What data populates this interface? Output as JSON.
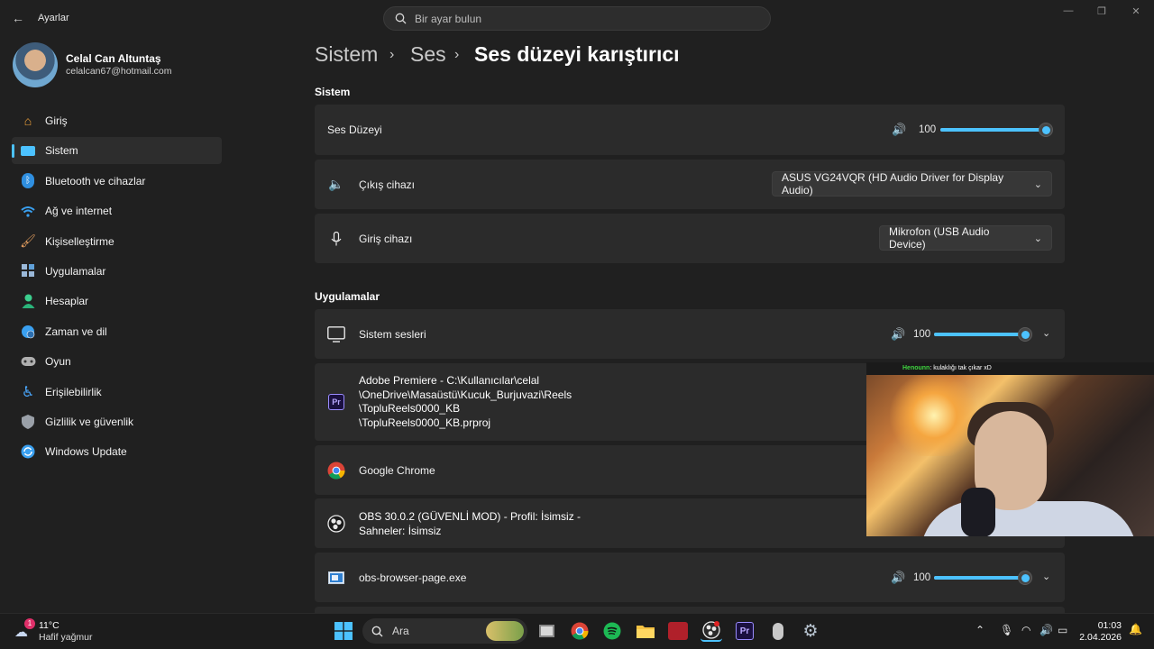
{
  "window": {
    "title": "Ayarlar",
    "search_placeholder": "Bir ayar bulun",
    "controls": [
      "minimize-icon",
      "maximize-icon",
      "close-icon"
    ]
  },
  "profile": {
    "name": "Celal Can Altuntaş",
    "email": "celalcan67@hotmail.com"
  },
  "sidebar": {
    "items": [
      {
        "label": "Giriş",
        "icon": "home-icon",
        "color": "#f3a33a"
      },
      {
        "label": "Sistem",
        "icon": "system-icon",
        "color": "#4cc2ff",
        "active": true
      },
      {
        "label": "Bluetooth ve cihazlar",
        "icon": "bluetooth-icon",
        "color": "#2f8fe0"
      },
      {
        "label": "Ağ ve internet",
        "icon": "wifi-icon",
        "color": "#3aa0f0"
      },
      {
        "label": "Kişiselleştirme",
        "icon": "brush-icon",
        "color": "#e8a060"
      },
      {
        "label": "Uygulamalar",
        "icon": "apps-icon",
        "color": "#9ab8d8"
      },
      {
        "label": "Hesaplar",
        "icon": "account-icon",
        "color": "#3ccf8e"
      },
      {
        "label": "Zaman ve dil",
        "icon": "globe-clock-icon",
        "color": "#3aa0f0"
      },
      {
        "label": "Oyun",
        "icon": "gamepad-icon",
        "color": "#b0b0b0"
      },
      {
        "label": "Erişilebilirlik",
        "icon": "accessibility-icon",
        "color": "#4aa8ff"
      },
      {
        "label": "Gizlilik ve güvenlik",
        "icon": "shield-icon",
        "color": "#9aa0a8"
      },
      {
        "label": "Windows Update",
        "icon": "update-icon",
        "color": "#3aa0f0"
      }
    ]
  },
  "breadcrumb": {
    "level1": "Sistem",
    "level2": "Ses",
    "current": "Ses düzeyi karıştırıcı"
  },
  "system_section": {
    "title": "Sistem",
    "volume_label": "Ses Düzeyi",
    "volume_value": "100",
    "volume_level": 1.0,
    "output_label": "Çıkış cihazı",
    "output_device": "ASUS VG24VQR (HD Audio Driver for Display Audio)",
    "input_label": "Giriş cihazı",
    "input_device": "Mikrofon (USB Audio Device)"
  },
  "apps_section": {
    "title": "Uygulamalar",
    "apps": [
      {
        "name": "Sistem sesleri",
        "icon": "monitor-icon",
        "volume": "100",
        "level": 1.0
      },
      {
        "name_lines": [
          "Adobe Premiere - C:\\Kullanıcılar\\celal",
          "\\OneDrive\\Masaüstü\\Kucuk_Burjuvazi\\Reels",
          "\\TopluReels0000_KB",
          "\\TopluReels0000_KB.prproj"
        ],
        "icon": "premiere-icon"
      },
      {
        "name": "Google Chrome",
        "icon": "chrome-icon"
      },
      {
        "name_lines": [
          "OBS 30.0.2 (GÜVENLİ MOD) - Profil: İsimsiz -",
          "Sahneler: İsimsiz"
        ],
        "icon": "obs-icon"
      },
      {
        "name": "obs-browser-page.exe",
        "icon": "browser-page-icon",
        "volume": "100",
        "level": 1.0
      }
    ]
  },
  "overlay": {
    "chat_user": "Henounn",
    "chat_text": ": kulaklığı tak çıkar xD"
  },
  "taskbar": {
    "weather_badge": "1",
    "temperature": "11°C",
    "weather_desc": "Hafif yağmur",
    "search_label": "Ara",
    "time": "01:03",
    "date": "2.04.2026",
    "accent": "#4cc2ff"
  }
}
